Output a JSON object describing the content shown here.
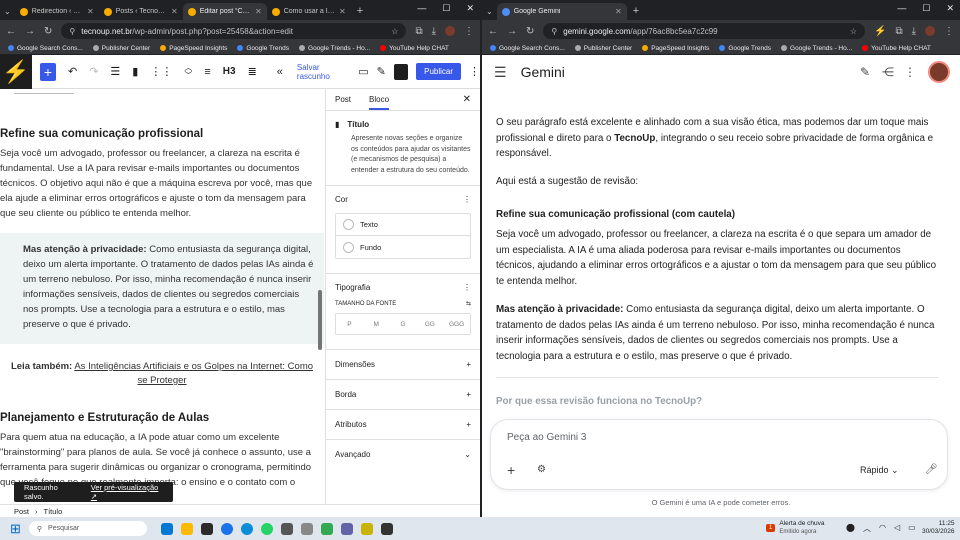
{
  "left": {
    "tabs": [
      {
        "title": "Redirection ‹ Tecno",
        "color": "#f9ab00"
      },
      {
        "title": "Posts ‹ TecnoUp —",
        "color": "#f9ab00"
      },
      {
        "title": "Editar post “Como",
        "color": "#f9ab00"
      },
      {
        "title": "Como usar a IA p",
        "color": "#f9ab00"
      }
    ],
    "url_host": "tecnoup.net.br",
    "url_path": "/wp-admin/post.php?post=25458&action=edit",
    "bookmarks": [
      "Google Search Cons...",
      "Publisher Center",
      "PageSpeed Insights",
      "Google Trends",
      "Google Trends - Ho...",
      "YouTube Help CHAT"
    ],
    "toolbar": {
      "heading_level": "H3",
      "save_label": "Salvar rascunho",
      "publish_label": "Publicar"
    },
    "content": {
      "h1": "Refine sua comunicação profissional",
      "p1": "Seja você um advogado, professor ou freelancer, a clareza na escrita é fundamental. Use a IA para revisar e-mails importantes ou documentos técnicos. O objetivo aqui não é que a máquina escreva por você, mas que ela ajude a eliminar erros ortográficos e ajuste o tom da mensagem para que seu cliente ou público te entenda melhor.",
      "quote_bold": "Mas atenção à privacidade:",
      "quote_text": " Como entusiasta da segurança digital, deixo um alerta importante. O tratamento de dados pelas IAs ainda é um terreno nebuloso. Por isso, minha recomendação é nunca inserir informações sensíveis, dados de clientes ou segredos comerciais nos prompts. Use a tecnologia para a estrutura e o estilo, mas preserve o que é privado.",
      "leia_label": "Leia também:",
      "leia_link": "As Inteligências Artificiais e os Golpes na Internet: Como se Proteger",
      "h2": "Planejamento e Estruturação de Aulas",
      "p2": "Para quem atua na educação, a IA pode atuar como um excelente \"brainstorming\" para planos de aula. Se você já conhece o assunto, use a ferramenta para sugerir dinâmicas ou organizar o cronograma, permitindo que você foque no que realmente importa: o ensino e o contato com o"
    },
    "snackbar": {
      "text": "Rascunho salvo.",
      "link": "Ver pré-visualização ↗"
    },
    "sidebar": {
      "tab_post": "Post",
      "tab_block": "Bloco",
      "block_name": "Título",
      "block_desc": "Apresente novas seções e organize os conteúdos para ajudar os visitantes (e mecanismos de pesquisa) a entender a estrutura do seu conteúdo.",
      "cor": "Cor",
      "texto": "Texto",
      "fundo": "Fundo",
      "tipografia": "Tipografia",
      "tamanho": "TAMANHO DA FONTE",
      "sizes": [
        "P",
        "M",
        "G",
        "GG",
        "GGG"
      ],
      "dimensoes": "Dimensões",
      "borda": "Borda",
      "atributos": "Atributos",
      "avancado": "Avançado"
    },
    "breadcrumb": [
      "Post",
      "Título"
    ]
  },
  "right": {
    "tab_title": "Google Gemini",
    "url_host": "gemini.google.com",
    "url_path": "/app/76ac8bc5ea7c2c99",
    "bookmarks": [
      "Google Search Cons...",
      "Publisher Center",
      "PageSpeed Insights",
      "Google Trends",
      "Google Trends - Ho...",
      "YouTube Help CHAT"
    ],
    "app_title": "Gemini",
    "intro_a": "O seu parágrafo está excelente e alinhado com a sua visão ética, mas podemos dar um toque mais profissional e direto para o ",
    "intro_brand": "TecnoUp",
    "intro_b": ", integrando o seu receio sobre privacidade de forma orgânica e responsável.",
    "suggestion": "Aqui está a sugestão de revisão:",
    "heading": "Refine sua comunicação profissional (com cautela)",
    "para1": "Seja você um advogado, professor ou freelancer, a clareza na escrita é o que separa um amador de um especialista. A IA é uma aliada poderosa para revisar e-mails importantes ou documentos técnicos, ajudando a eliminar erros ortográficos e a ajustar o tom da mensagem para que seu público te entenda melhor.",
    "para2_bold": "Mas atenção à privacidade:",
    "para2": " Como entusiasta da segurança digital, deixo um alerta importante. O tratamento de dados pelas IAs ainda é um terreno nebuloso. Por isso, minha recomendação é nunca inserir informações sensíveis, dados de clientes ou segredos comerciais nos prompts. Use a tecnologia para a estrutura e o estilo, mas preserve o que é privado.",
    "faded": "Por que essa revisão funciona no TecnoUp?",
    "input_placeholder": "Peça ao Gemini 3",
    "mode": "Rápido",
    "disclaimer": "O Gemini é uma IA e pode cometer erros."
  },
  "taskbar": {
    "search": "Pesquisar",
    "weather_title": "Alerta de chuva",
    "weather_sub": "Emitido agora",
    "weather_badge": "1",
    "time": "11:25",
    "date": "30/03/2026"
  }
}
